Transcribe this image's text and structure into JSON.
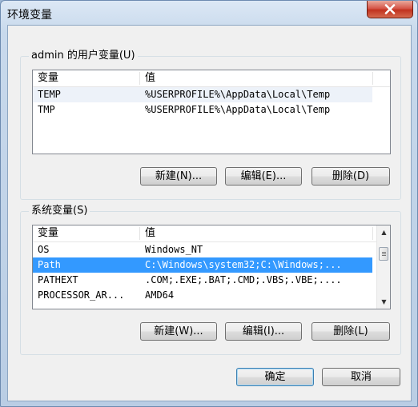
{
  "window": {
    "title": "环境变量",
    "close_icon": "close-icon"
  },
  "user_group": {
    "legend": "admin 的用户变量(U)",
    "columns": [
      "变量",
      "值"
    ],
    "rows": [
      {
        "name": "TEMP",
        "value": "%USERPROFILE%\\AppData\\Local\\Temp"
      },
      {
        "name": "TMP",
        "value": "%USERPROFILE%\\AppData\\Local\\Temp"
      }
    ],
    "buttons": {
      "new": "新建(N)...",
      "edit": "编辑(E)...",
      "delete": "删除(D)"
    }
  },
  "system_group": {
    "legend": "系统变量(S)",
    "columns": [
      "变量",
      "值"
    ],
    "rows": [
      {
        "name": "OS",
        "value": "Windows_NT"
      },
      {
        "name": "Path",
        "value": "C:\\Windows\\system32;C:\\Windows;..."
      },
      {
        "name": "PATHEXT",
        "value": ".COM;.EXE;.BAT;.CMD;.VBS;.VBE;...."
      },
      {
        "name": "PROCESSOR_AR...",
        "value": "AMD64"
      }
    ],
    "selected_row": "Path",
    "buttons": {
      "new": "新建(W)...",
      "edit": "编辑(I)...",
      "delete": "删除(L)"
    }
  },
  "footer": {
    "ok": "确定",
    "cancel": "取消"
  }
}
